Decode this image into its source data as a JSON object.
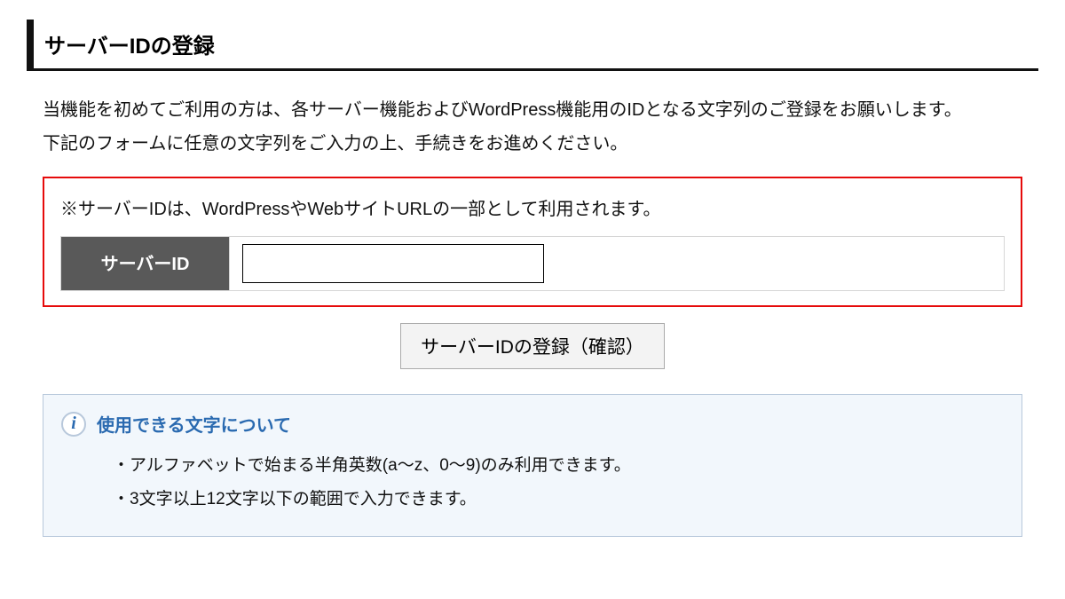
{
  "header": {
    "title": "サーバーIDの登録"
  },
  "intro": {
    "line1": "当機能を初めてご利用の方は、各サーバー機能およびWordPress機能用のIDとなる文字列のご登録をお願いします。",
    "line2": "下記のフォームに任意の文字列をご入力の上、手続きをお進めください。"
  },
  "form": {
    "note": "※サーバーIDは、WordPressやWebサイトURLの一部として利用されます。",
    "label": "サーバーID",
    "input_value": "",
    "submit_label": "サーバーIDの登録（確認）"
  },
  "info": {
    "title": "使用できる文字について",
    "items": [
      "・アルファベットで始まる半角英数(a～z、0～9)のみ利用できます。",
      "・3文字以上12文字以下の範囲で入力できます。"
    ]
  }
}
